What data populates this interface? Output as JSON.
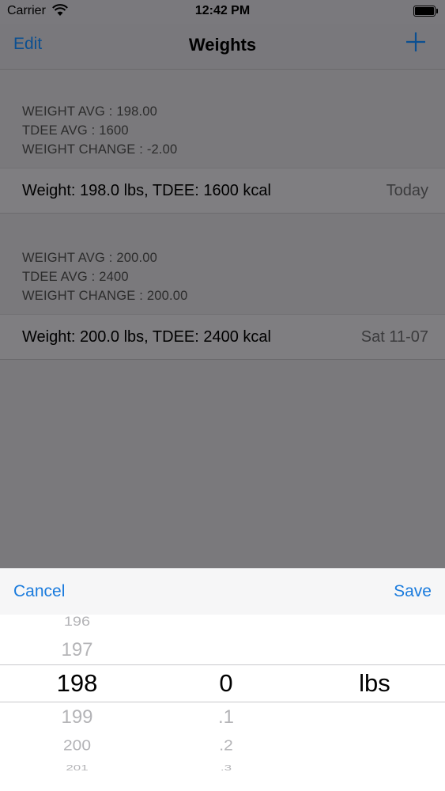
{
  "status_bar": {
    "carrier": "Carrier",
    "time": "12:42 PM"
  },
  "nav": {
    "edit_label": "Edit",
    "title": "Weights",
    "add_icon": "plus-icon",
    "accent_color": "#0b4f91"
  },
  "sections": [
    {
      "header_lines": [
        "WEIGHT AVG : 198.00",
        "TDEE AVG : 1600",
        "WEIGHT CHANGE : -2.00"
      ],
      "row": {
        "text": "Weight: 198.0 lbs, TDEE: 1600 kcal",
        "date": "Today"
      }
    },
    {
      "header_lines": [
        "WEIGHT AVG : 200.00",
        "TDEE AVG : 2400",
        "WEIGHT CHANGE : 200.00"
      ],
      "row": {
        "text": "Weight: 200.0 lbs, TDEE: 2400 kcal",
        "date": "Sat 11-07"
      }
    }
  ],
  "sheet": {
    "cancel_label": "Cancel",
    "save_label": "Save",
    "button_color": "#1a7bdd"
  },
  "picker": {
    "whole": {
      "above": [
        "196",
        "197"
      ],
      "selected": "198",
      "below": [
        "199",
        "200",
        "201"
      ]
    },
    "decimal": {
      "above": [],
      "selected": "0",
      "below": [
        ".1",
        ".2",
        ".3"
      ]
    },
    "unit": {
      "selected": "lbs"
    }
  }
}
